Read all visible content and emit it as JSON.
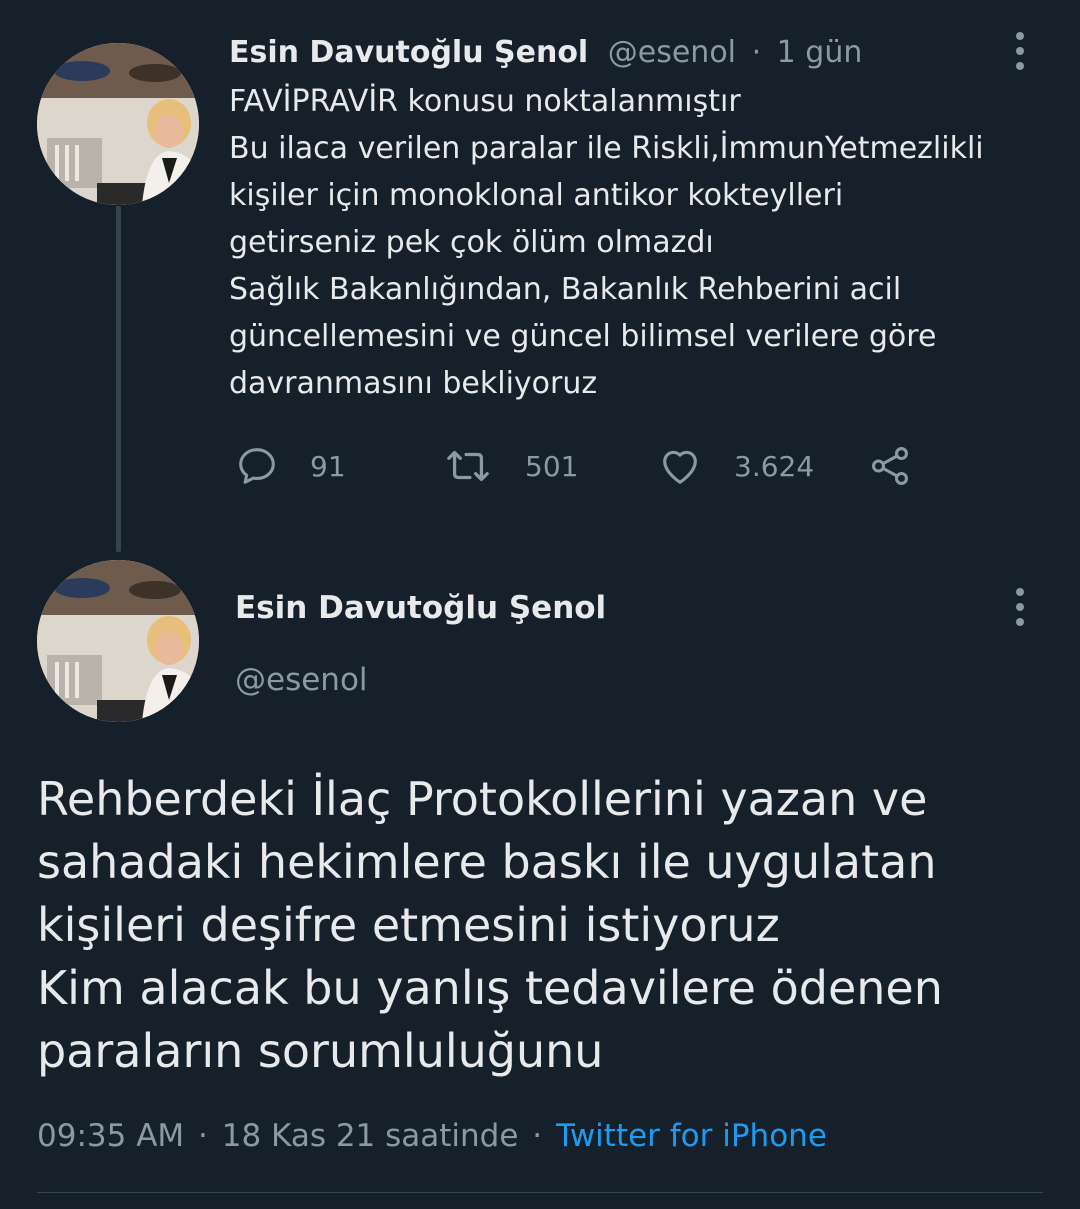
{
  "tweet1": {
    "author_name": "Esin Davutoğlu Şenol",
    "handle": "@esenol",
    "separator": "·",
    "time": "1 gün",
    "lines": [
      "FAVİPRAVİR konusu noktalanmıştır",
      "Bu ilaca verilen paralar ile Riskli,İmmunYetmezlikli",
      "kişiler için monoklonal antikor kokteylleri",
      "getirseniz pek çok ölüm olmazdı",
      "Sağlık Bakanlığından, Bakanlık Rehberini acil",
      "güncellemesini ve güncel bilimsel verilere göre",
      "davranmasını bekliyoruz"
    ],
    "actions": {
      "replies": "91",
      "retweets": "501",
      "likes": "3.624"
    }
  },
  "tweet2": {
    "author_name": "Esin Davutoğlu Şenol",
    "handle": "@esenol",
    "lines": [
      "Rehberdeki İlaç Protokollerini yazan ve",
      "sahadaki hekimlere baskı ile uygulatan",
      "kişileri deşifre etmesini istiyoruz",
      "Kim alacak bu yanlış tedavilere ödenen",
      "paraların sorumluluğunu"
    ],
    "time": "09:35 AM",
    "sep1": "·",
    "date": "18 Kas 21 saatinde",
    "sep2": "·",
    "source": "Twitter for iPhone"
  },
  "icons": {
    "reply": "reply-icon",
    "retweet": "retweet-icon",
    "like": "heart-icon",
    "share": "share-icon",
    "more": "more-vertical-icon"
  },
  "colors": {
    "background": "#15202b",
    "text": "#e7e9ea",
    "muted": "#8b98a5",
    "link": "#1d9bf0"
  }
}
